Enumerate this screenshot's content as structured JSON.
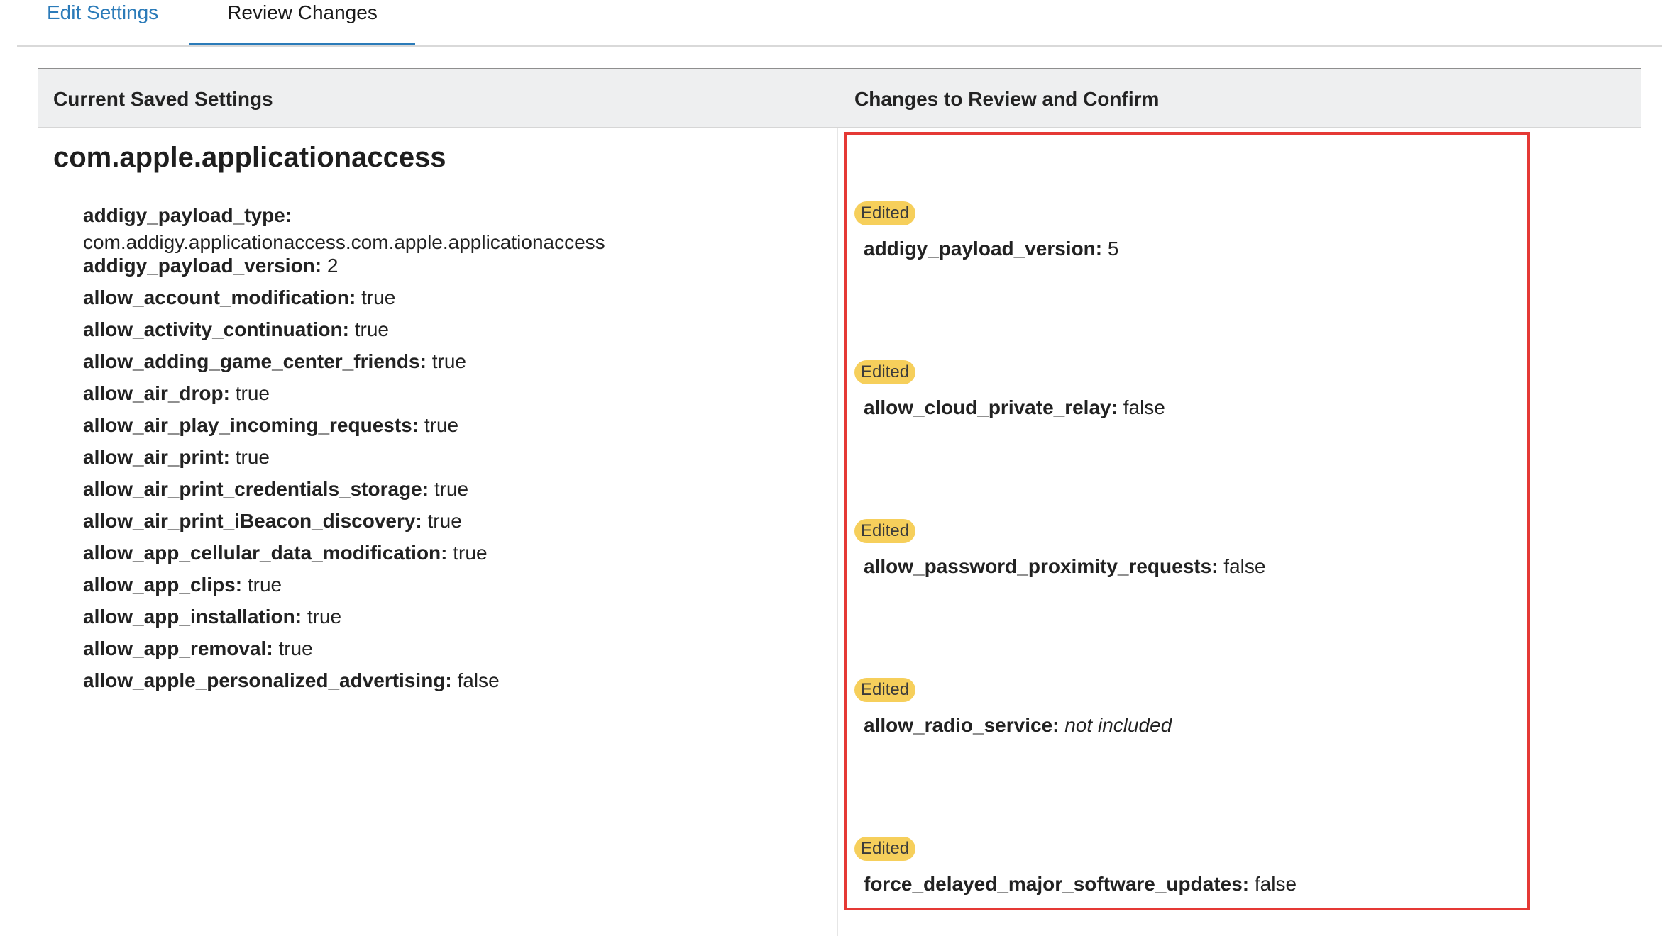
{
  "tabs": [
    {
      "label": "Edit Settings",
      "active": false
    },
    {
      "label": "Review Changes",
      "active": true
    }
  ],
  "columns": {
    "left_header": "Current Saved Settings",
    "right_header": "Changes to Review and Confirm"
  },
  "domain_title": "com.apple.applicationaccess",
  "current_settings": [
    {
      "key": "addigy_payload_type:",
      "value": "com.addigy.applicationaccess.com.apple.applicationaccess"
    },
    {
      "key": "addigy_payload_version:",
      "value": "2"
    },
    {
      "key": "allow_account_modification:",
      "value": "true"
    },
    {
      "key": "allow_activity_continuation:",
      "value": "true"
    },
    {
      "key": "allow_adding_game_center_friends:",
      "value": "true"
    },
    {
      "key": "allow_air_drop:",
      "value": "true"
    },
    {
      "key": "allow_air_play_incoming_requests:",
      "value": "true"
    },
    {
      "key": "allow_air_print:",
      "value": "true"
    },
    {
      "key": "allow_air_print_credentials_storage:",
      "value": "true"
    },
    {
      "key": "allow_air_print_iBeacon_discovery:",
      "value": "true"
    },
    {
      "key": "allow_app_cellular_data_modification:",
      "value": "true"
    },
    {
      "key": "allow_app_clips:",
      "value": "true"
    },
    {
      "key": "allow_app_installation:",
      "value": "true"
    },
    {
      "key": "allow_app_removal:",
      "value": "true"
    },
    {
      "key": "allow_apple_personalized_advertising:",
      "value": "false"
    }
  ],
  "changes": [
    {
      "badge": "Edited",
      "key": "addigy_payload_version:",
      "value": "5"
    },
    {
      "badge": "Edited",
      "key": "allow_cloud_private_relay:",
      "value": "false"
    },
    {
      "badge": "Edited",
      "key": "allow_password_proximity_requests:",
      "value": "false"
    },
    {
      "badge": "Edited",
      "key": "allow_radio_service:",
      "value": "not included"
    },
    {
      "badge": "Edited",
      "key": "force_delayed_major_software_updates:",
      "value": "false"
    }
  ],
  "colors": {
    "accent": "#2b7bb9",
    "badge": "#f6cf5b",
    "highlight": "#e53935",
    "header_bg": "#eeeff0"
  }
}
